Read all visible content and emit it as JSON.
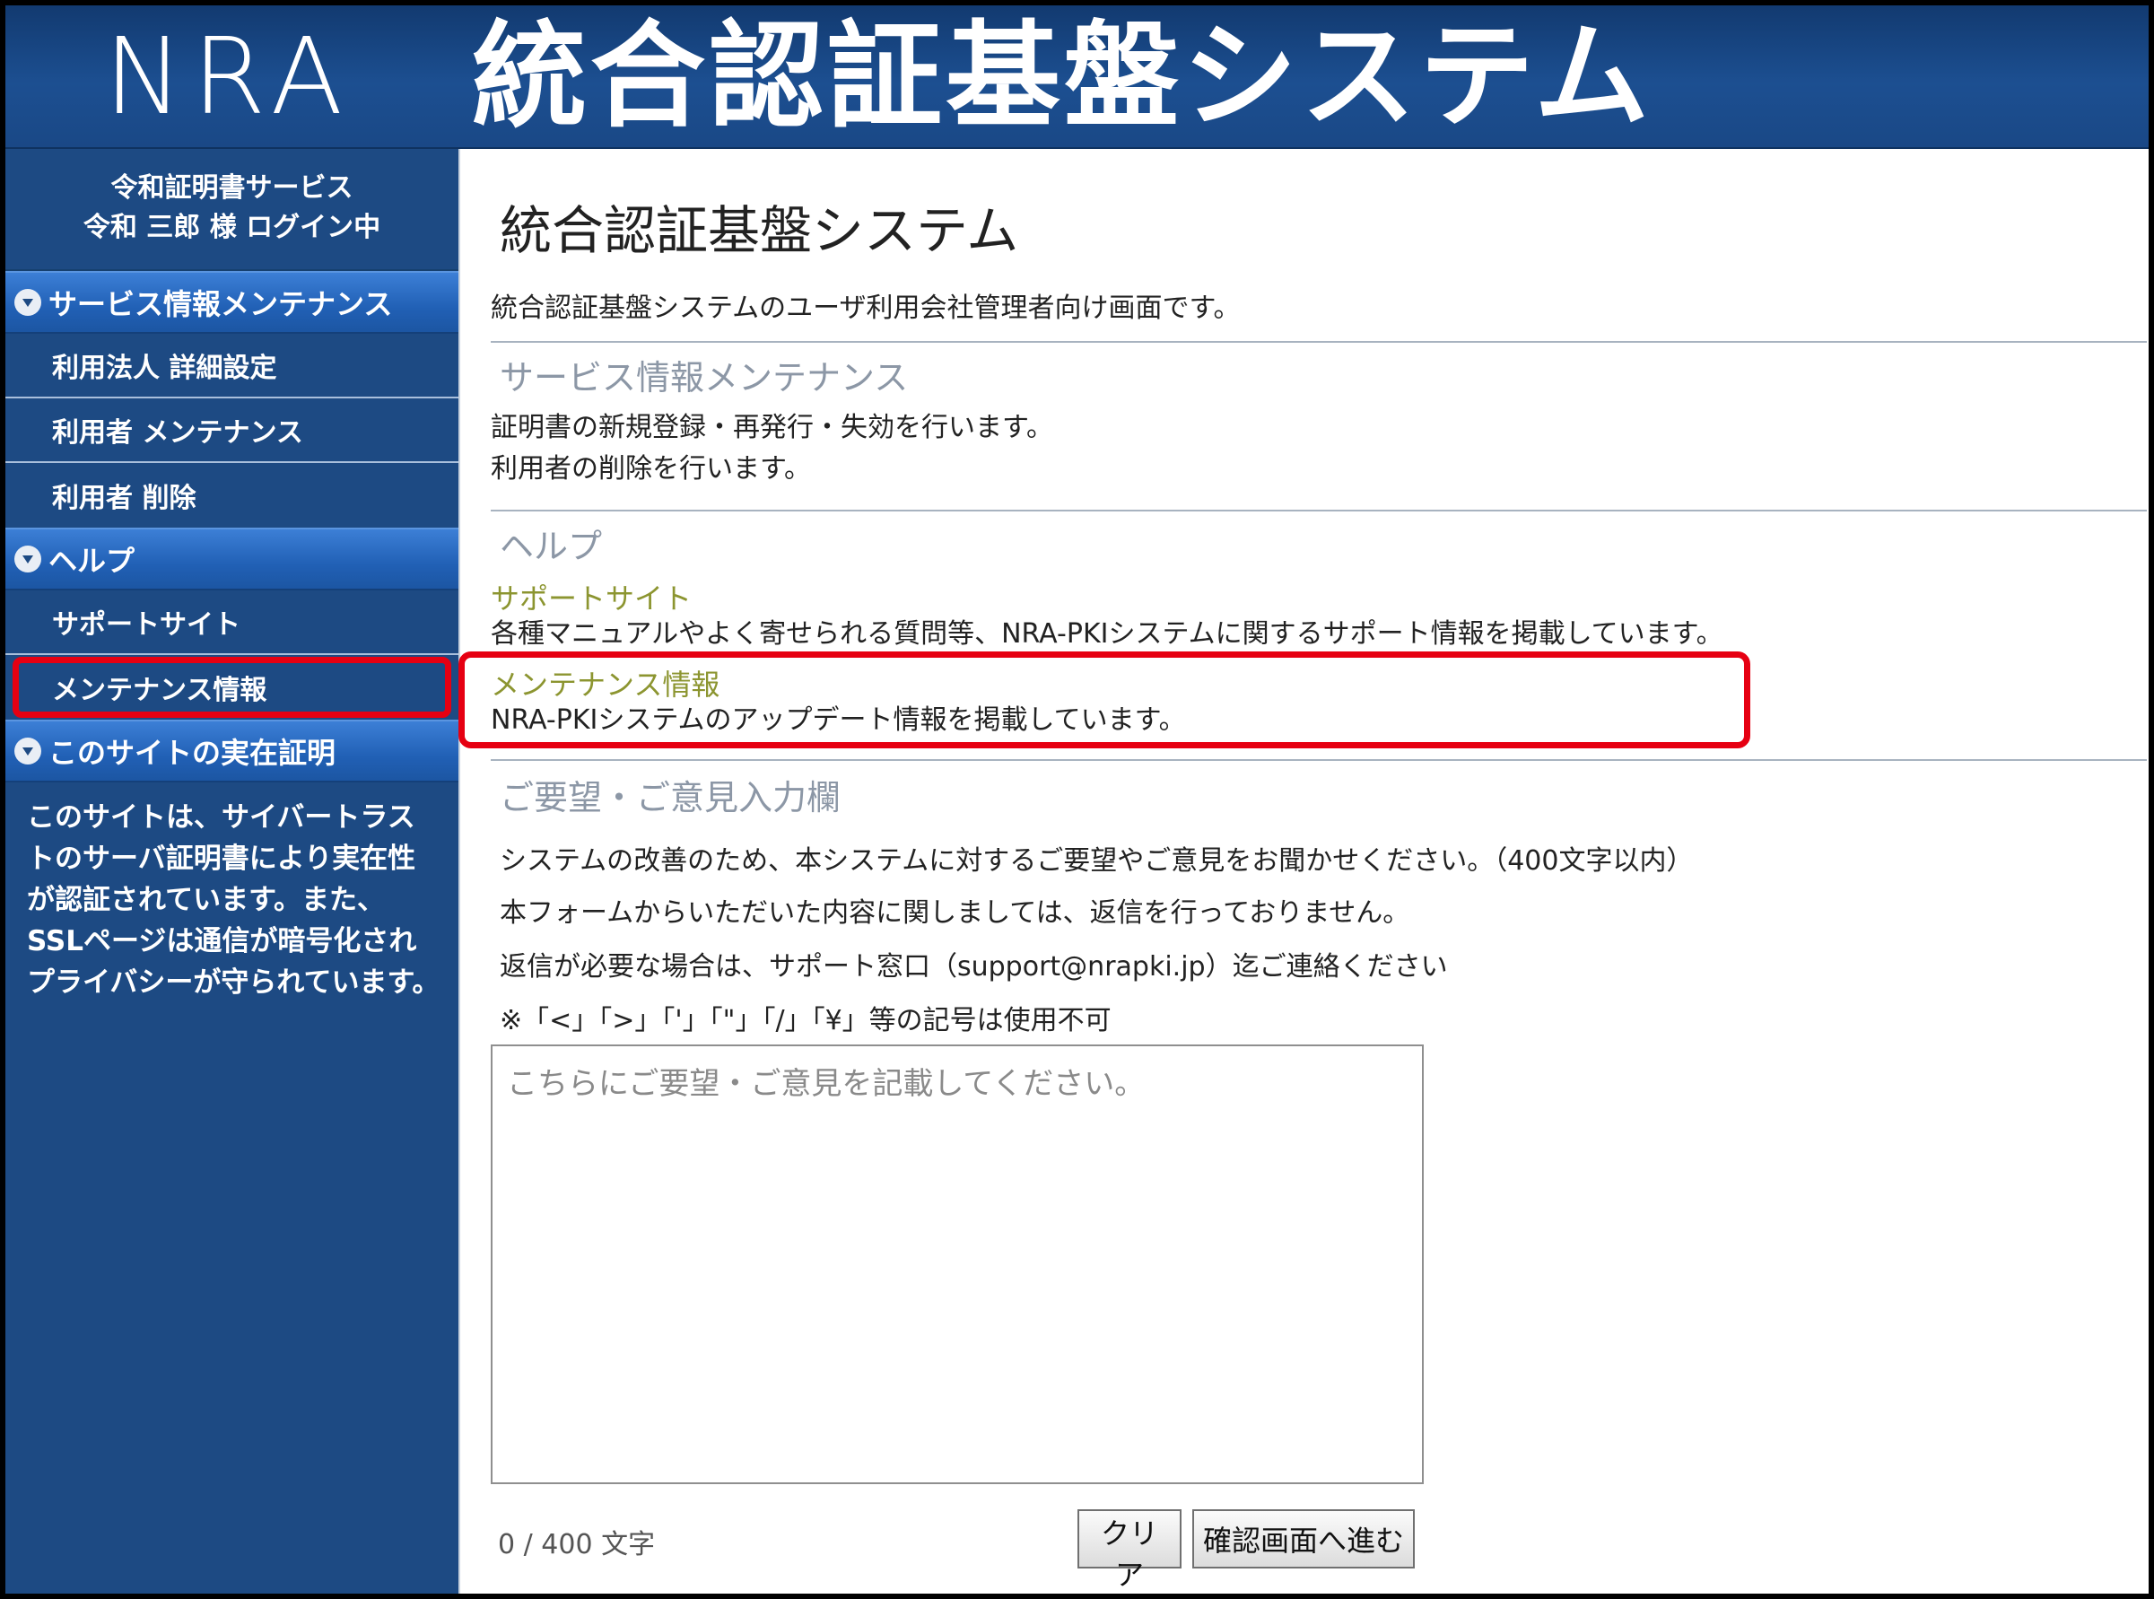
{
  "header": {
    "logo": "NRA",
    "title": "統合認証基盤システム"
  },
  "sidebar": {
    "user": {
      "service": "令和証明書サービス",
      "login_status": "令和 三郎 様 ログイン中"
    },
    "sections": [
      {
        "title": "サービス情報メンテナンス",
        "items": [
          "利用法人 詳細設定",
          "利用者 メンテナンス",
          "利用者 削除"
        ]
      },
      {
        "title": "ヘルプ",
        "items": [
          "サポートサイト",
          "メンテナンス情報"
        ]
      },
      {
        "title": "このサイトの実在証明",
        "text": "このサイトは、サイバートラストのサーバ証明書により実在性が認証されています。また、SSLページは通信が暗号化されプライバシーが守られています。"
      }
    ]
  },
  "main": {
    "title": "統合認証基盤システム",
    "intro": "統合認証基盤システムのユーザ利用会社管理者向け画面です。",
    "service_section": {
      "title": "サービス情報メンテナンス",
      "lines": [
        "証明書の新規登録・再発行・失効を行います。",
        "利用者の削除を行います。"
      ]
    },
    "help_section": {
      "title": "ヘルプ",
      "support_title": "サポートサイト",
      "support_text": "各種マニュアルやよく寄せられる質問等、NRA-PKIシステムに関するサポート情報を掲載しています。",
      "maintenance_title": "メンテナンス情報",
      "maintenance_text": "NRA-PKIシステムのアップデート情報を掲載しています。"
    },
    "feedback": {
      "title": "ご要望・ご意見入力欄",
      "lines": [
        "システムの改善のため、本システムに対するご要望やご意見をお聞かせください。（400文字以内）",
        "本フォームからいただいた内容に関しましては、返信を行っておりません。",
        "返信が必要な場合は、サポート窓口（support@nrapki.jp）迄ご連絡ください",
        "※「<」「>」「'」「\"」「/」「¥」等の記号は使用不可"
      ],
      "placeholder": "こちらにご要望・ご意見を記載してください。",
      "counter": "0 / 400 文字",
      "clear_label": "クリア",
      "confirm_label": "確認画面へ進む"
    }
  },
  "colors": {
    "header_bg": "#1c4f91",
    "sidebar_bg": "#1d4a83",
    "section_head": "#2160b5",
    "highlight": "#e60012",
    "link_title": "#8c9530",
    "section_title": "#8c97a6"
  }
}
